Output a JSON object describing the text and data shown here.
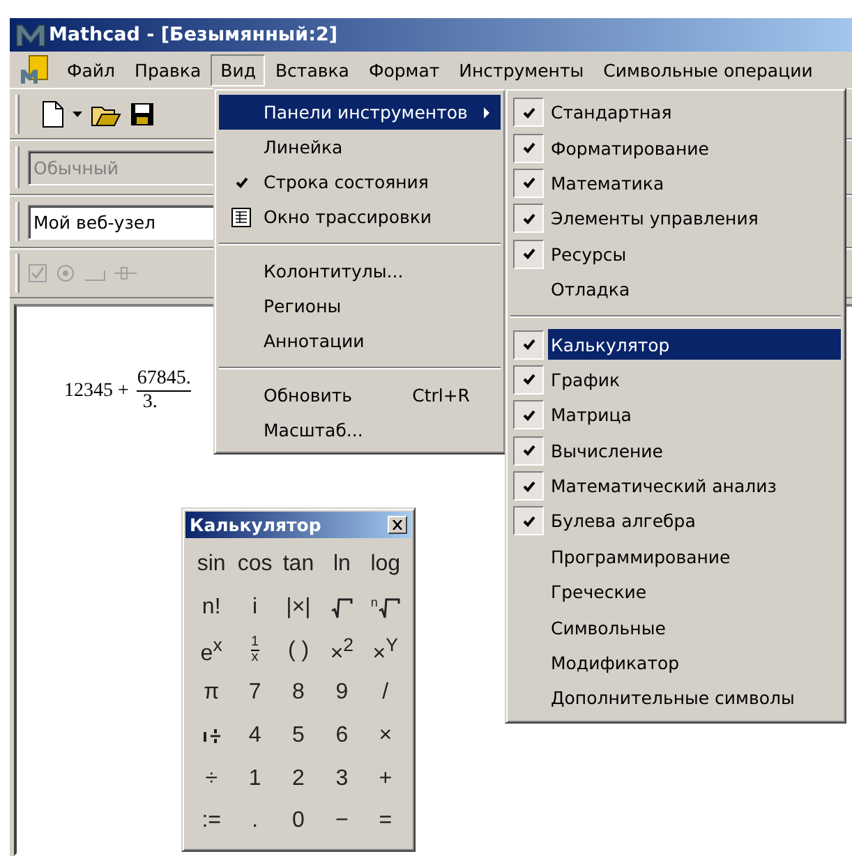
{
  "window": {
    "title": "Mathcad - [Безымянный:2]"
  },
  "menubar": [
    {
      "label": "Файл",
      "selected": false
    },
    {
      "label": "Правка",
      "selected": false
    },
    {
      "label": "Вид",
      "selected": true
    },
    {
      "label": "Вставка",
      "selected": false
    },
    {
      "label": "Формат",
      "selected": false
    },
    {
      "label": "Инструменты",
      "selected": false
    },
    {
      "label": "Символьные операции",
      "selected": false
    }
  ],
  "style_box": {
    "value": "Обычный",
    "disabled": true
  },
  "site_box": {
    "value": "Мой веб-узел",
    "disabled": false
  },
  "document": {
    "left": "12345 +",
    "numerator": "67845.",
    "denominator": "3."
  },
  "view_menu": [
    {
      "kind": "item",
      "label": "Панели инструментов",
      "checked": false,
      "selected": true,
      "submenu": true
    },
    {
      "kind": "item",
      "label": "Линейка",
      "checked": false,
      "selected": false,
      "submenu": false
    },
    {
      "kind": "item",
      "label": "Строка состояния",
      "checked": true,
      "selected": false,
      "submenu": false
    },
    {
      "kind": "icon",
      "label": "Окно трассировки",
      "selected": false,
      "submenu": false
    },
    {
      "kind": "separator"
    },
    {
      "kind": "item",
      "label": "Колонтитулы...",
      "checked": false,
      "selected": false,
      "submenu": false
    },
    {
      "kind": "item",
      "label": "Регионы",
      "checked": false,
      "selected": false,
      "submenu": false
    },
    {
      "kind": "item",
      "label": "Аннотации",
      "checked": false,
      "selected": false,
      "submenu": false
    },
    {
      "kind": "separator"
    },
    {
      "kind": "item",
      "label": "Обновить",
      "shortcut": "Ctrl+R",
      "checked": false,
      "selected": false,
      "submenu": false
    },
    {
      "kind": "item",
      "label": "Масштаб...",
      "checked": false,
      "selected": false,
      "submenu": false
    }
  ],
  "toolbars_menu": [
    {
      "kind": "item",
      "label": "Стандартная",
      "checked": true,
      "selected": false
    },
    {
      "kind": "item",
      "label": "Форматирование",
      "checked": true,
      "selected": false
    },
    {
      "kind": "item",
      "label": "Математика",
      "checked": true,
      "selected": false
    },
    {
      "kind": "item",
      "label": "Элементы управления",
      "checked": true,
      "selected": false
    },
    {
      "kind": "item",
      "label": "Ресурсы",
      "checked": true,
      "selected": false
    },
    {
      "kind": "item",
      "label": "Отладка",
      "checked": false,
      "selected": false
    },
    {
      "kind": "separator"
    },
    {
      "kind": "item",
      "label": "Калькулятор",
      "checked": true,
      "selected": true
    },
    {
      "kind": "item",
      "label": "График",
      "checked": true,
      "selected": false
    },
    {
      "kind": "item",
      "label": "Матрица",
      "checked": true,
      "selected": false
    },
    {
      "kind": "item",
      "label": "Вычисление",
      "checked": true,
      "selected": false
    },
    {
      "kind": "item",
      "label": "Математический анализ",
      "checked": true,
      "selected": false
    },
    {
      "kind": "item",
      "label": "Булева алгебра",
      "checked": true,
      "selected": false
    },
    {
      "kind": "item",
      "label": "Программирование",
      "checked": false,
      "selected": false
    },
    {
      "kind": "item",
      "label": "Греческие",
      "checked": false,
      "selected": false
    },
    {
      "kind": "item",
      "label": "Символьные",
      "checked": false,
      "selected": false
    },
    {
      "kind": "item",
      "label": "Модификатор",
      "checked": false,
      "selected": false
    },
    {
      "kind": "item",
      "label": "Дополнительные символы",
      "checked": false,
      "selected": false
    }
  ],
  "calculator": {
    "title": "Калькулятор",
    "keys": [
      {
        "kind": "text",
        "label": "sin"
      },
      {
        "kind": "text",
        "label": "cos"
      },
      {
        "kind": "text",
        "label": "tan"
      },
      {
        "kind": "text",
        "label": "ln"
      },
      {
        "kind": "text",
        "label": "log"
      },
      {
        "kind": "text",
        "label": "n!"
      },
      {
        "kind": "text",
        "label": "i"
      },
      {
        "kind": "text",
        "label": "|×|"
      },
      {
        "kind": "root"
      },
      {
        "kind": "root",
        "index": "n"
      },
      {
        "kind": "text",
        "label": "e$^{x}$"
      },
      {
        "kind": "frac",
        "num": "1",
        "den": "x"
      },
      {
        "kind": "text",
        "label": "( )"
      },
      {
        "kind": "text",
        "label": "×$^{2}$"
      },
      {
        "kind": "text",
        "label": "×$^{Y}$"
      },
      {
        "kind": "text",
        "label": "π"
      },
      {
        "kind": "text",
        "label": "7"
      },
      {
        "kind": "text",
        "label": "8"
      },
      {
        "kind": "text",
        "label": "9"
      },
      {
        "kind": "text",
        "label": "/"
      },
      {
        "kind": "range"
      },
      {
        "kind": "text",
        "label": "4"
      },
      {
        "kind": "text",
        "label": "5"
      },
      {
        "kind": "text",
        "label": "6"
      },
      {
        "kind": "text",
        "label": "×"
      },
      {
        "kind": "text",
        "label": "÷"
      },
      {
        "kind": "text",
        "label": "1"
      },
      {
        "kind": "text",
        "label": "2"
      },
      {
        "kind": "text",
        "label": "3"
      },
      {
        "kind": "text",
        "label": "+"
      },
      {
        "kind": "text",
        "label": ":="
      },
      {
        "kind": "text",
        "label": "."
      },
      {
        "kind": "text",
        "label": "0"
      },
      {
        "kind": "text",
        "label": "−"
      },
      {
        "kind": "text",
        "label": "="
      }
    ]
  }
}
